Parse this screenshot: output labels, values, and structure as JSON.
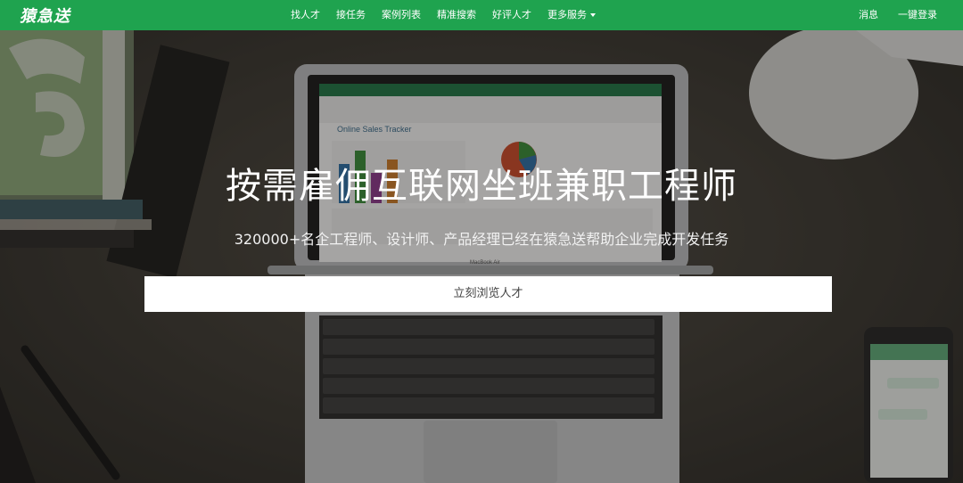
{
  "brand": {
    "logo_text": "猿急送"
  },
  "nav": {
    "items": [
      {
        "label": "找人才"
      },
      {
        "label": "接任务"
      },
      {
        "label": "案例列表"
      },
      {
        "label": "精准搜索"
      },
      {
        "label": "好评人才"
      },
      {
        "label": "更多服务"
      }
    ],
    "messages_label": "消息",
    "login_label": "一键登录"
  },
  "hero": {
    "title": "按需雇佣互联网坐班兼职工程师",
    "subtitle": "320000+名企工程师、设计师、产品经理已经在猿急送帮助企业完成开发任务",
    "cta_label": "立刻浏览人才"
  },
  "screen_content": {
    "sheet_title": "Online Sales Tracker",
    "laptop_brand": "MacBook Air"
  },
  "colors": {
    "nav_bg": "#1fa34f",
    "cta_bg": "#ffffff",
    "excel_green": "#217346"
  }
}
